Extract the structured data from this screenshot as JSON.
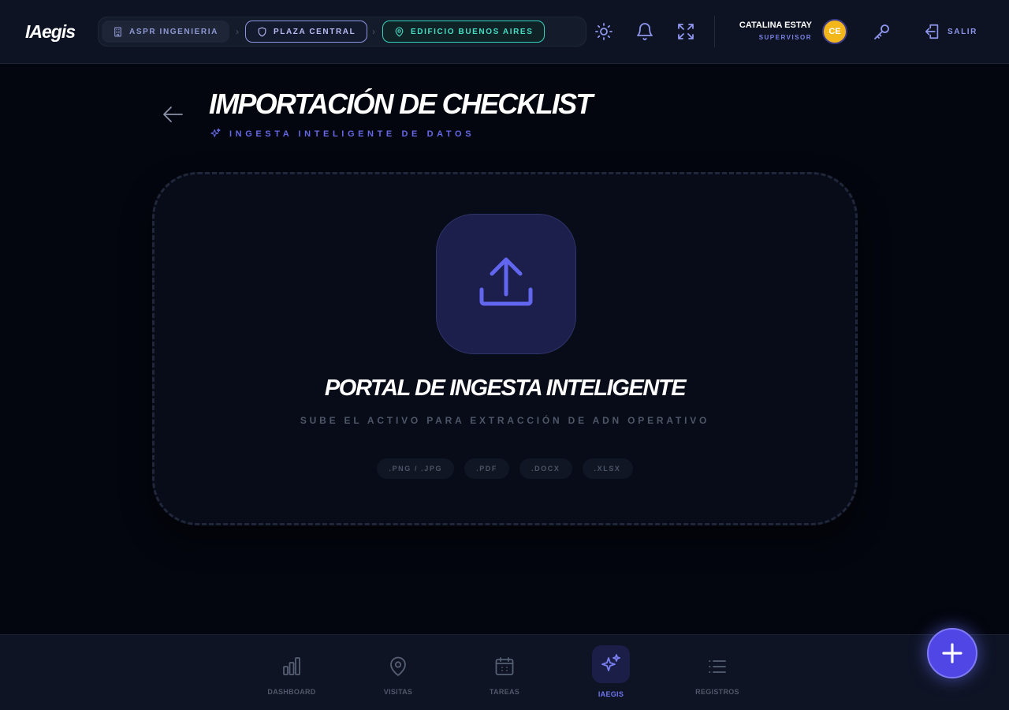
{
  "app": {
    "logo": "IAegis"
  },
  "breadcrumb": [
    {
      "label": "ASPR INGENIERIA",
      "icon": "building-icon"
    },
    {
      "label": "PLAZA CENTRAL",
      "icon": "shield-icon"
    },
    {
      "label": "EDIFICIO BUENOS AIRES",
      "icon": "map-pin-icon"
    }
  ],
  "toolbar": {
    "icons": [
      "sun-icon",
      "bell-icon",
      "fullscreen-icon",
      "key-icon",
      "logout-icon"
    ],
    "logout_label": "SALIR"
  },
  "user": {
    "name": "CATALINA ESTAY",
    "role": "SUPERVISOR",
    "initials": "CE"
  },
  "header": {
    "title": "IMPORTACIÓN DE CHECKLIST",
    "subtitle": "INGESTA INTELIGENTE DE DATOS"
  },
  "dropzone": {
    "title": "PORTAL DE INGESTA INTELIGENTE",
    "subtitle": "SUBE EL ACTIVO PARA EXTRACCIÓN DE ADN OPERATIVO",
    "formats": [
      ".PNG / .JPG",
      ".PDF",
      ".DOCX",
      ".XLSX"
    ]
  },
  "bottom_nav": [
    {
      "label": "DASHBOARD",
      "icon": "bar-chart-icon",
      "active": false
    },
    {
      "label": "VISITAS",
      "icon": "map-pin-icon",
      "active": false
    },
    {
      "label": "TAREAS",
      "icon": "calendar-icon",
      "active": false
    },
    {
      "label": "IAEGIS",
      "icon": "sparkles-icon",
      "active": true
    },
    {
      "label": "REGISTROS",
      "icon": "list-icon",
      "active": false
    }
  ],
  "colors": {
    "accent": "#6366f1",
    "teal": "#34d3bd",
    "avatar": "#f3b71c",
    "background": "#03060e"
  }
}
